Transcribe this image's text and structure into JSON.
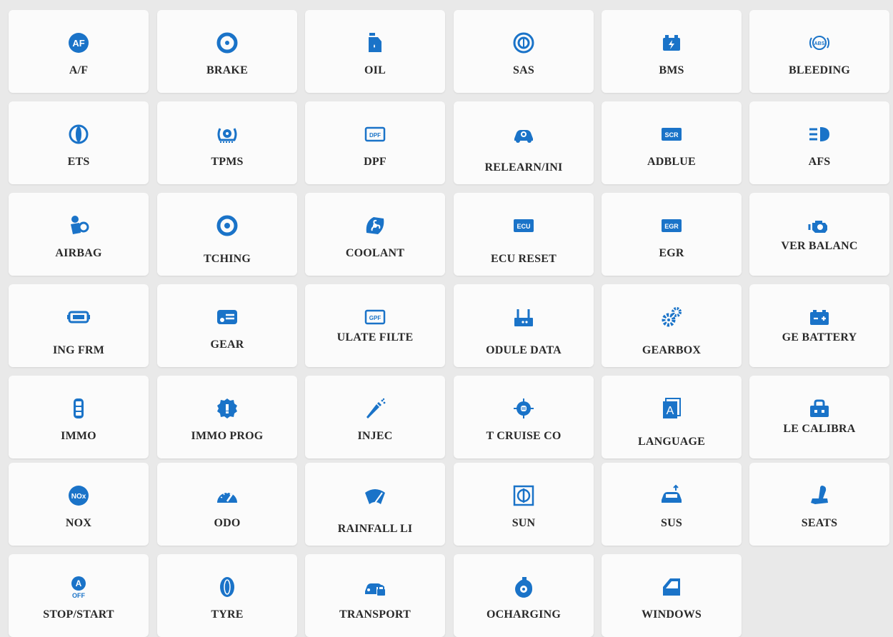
{
  "theme": {
    "accent": "#1a73c8",
    "tile_bg": "#fbfbfb",
    "page_bg": "#e9e9e9",
    "label": "#2a2a2a"
  },
  "tiles": [
    {
      "label": "A/F",
      "icon": "af-icon"
    },
    {
      "label": "BRAKE",
      "icon": "brake-disc-icon"
    },
    {
      "label": "OIL",
      "icon": "oil-can-icon"
    },
    {
      "label": "SAS",
      "icon": "steering-angle-icon"
    },
    {
      "label": "BMS",
      "icon": "battery-icon"
    },
    {
      "label": "BLEEDING",
      "icon": "abs-icon"
    },
    {
      "label": "ETS",
      "icon": "throttle-icon"
    },
    {
      "label": "TPMS",
      "icon": "tire-pressure-icon"
    },
    {
      "label": "DPF",
      "icon": "dpf-icon"
    },
    {
      "label": "RELEARN/INI",
      "icon": "car-gear-icon"
    },
    {
      "label": "ADBLUE",
      "icon": "scr-icon"
    },
    {
      "label": "AFS",
      "icon": "headlight-icon"
    },
    {
      "label": "AIRBAG",
      "icon": "airbag-icon"
    },
    {
      "label": "TCHING",
      "icon": "gear-matching-icon"
    },
    {
      "label": "COOLANT",
      "icon": "fan-icon"
    },
    {
      "label": "ECU RESET",
      "icon": "ecu-icon"
    },
    {
      "label": "EGR",
      "icon": "egr-icon"
    },
    {
      "label": "VER BALANC",
      "icon": "engine-icon"
    },
    {
      "label": "ING FRM",
      "icon": "module-icon"
    },
    {
      "label": "GEAR",
      "icon": "gear-box-icon"
    },
    {
      "label": "ULATE FILTE",
      "icon": "gpf-icon"
    },
    {
      "label": "ODULE DATA",
      "icon": "router-icon"
    },
    {
      "label": "GEARBOX",
      "icon": "gears-icon"
    },
    {
      "label": "GE BATTERY",
      "icon": "battery-plus-icon"
    },
    {
      "label": "IMMO",
      "icon": "key-fob-icon"
    },
    {
      "label": "IMMO PROG",
      "icon": "immo-gear-icon"
    },
    {
      "label": "INJEC",
      "icon": "injector-icon"
    },
    {
      "label": "T CRUISE CO",
      "icon": "cruise-target-icon"
    },
    {
      "label": "LANGUAGE",
      "icon": "language-icon"
    },
    {
      "label": "LE CALIBRA",
      "icon": "toolbox-icon"
    },
    {
      "label": "NOX",
      "icon": "nox-icon"
    },
    {
      "label": "ODO",
      "icon": "speedometer-icon"
    },
    {
      "label": "RAINFALL LI",
      "icon": "wiper-icon"
    },
    {
      "label": "SUN",
      "icon": "sun-sensor-icon"
    },
    {
      "label": "SUS",
      "icon": "suspension-icon"
    },
    {
      "label": "SEATS",
      "icon": "seat-icon"
    },
    {
      "label": "STOP/START",
      "icon": "stop-start-off-icon"
    },
    {
      "label": "TYRE",
      "icon": "tyre-icon"
    },
    {
      "label": "TRANSPORT",
      "icon": "car-lock-icon"
    },
    {
      "label": "OCHARGING",
      "icon": "turbo-icon"
    },
    {
      "label": "WINDOWS",
      "icon": "window-icon"
    }
  ]
}
